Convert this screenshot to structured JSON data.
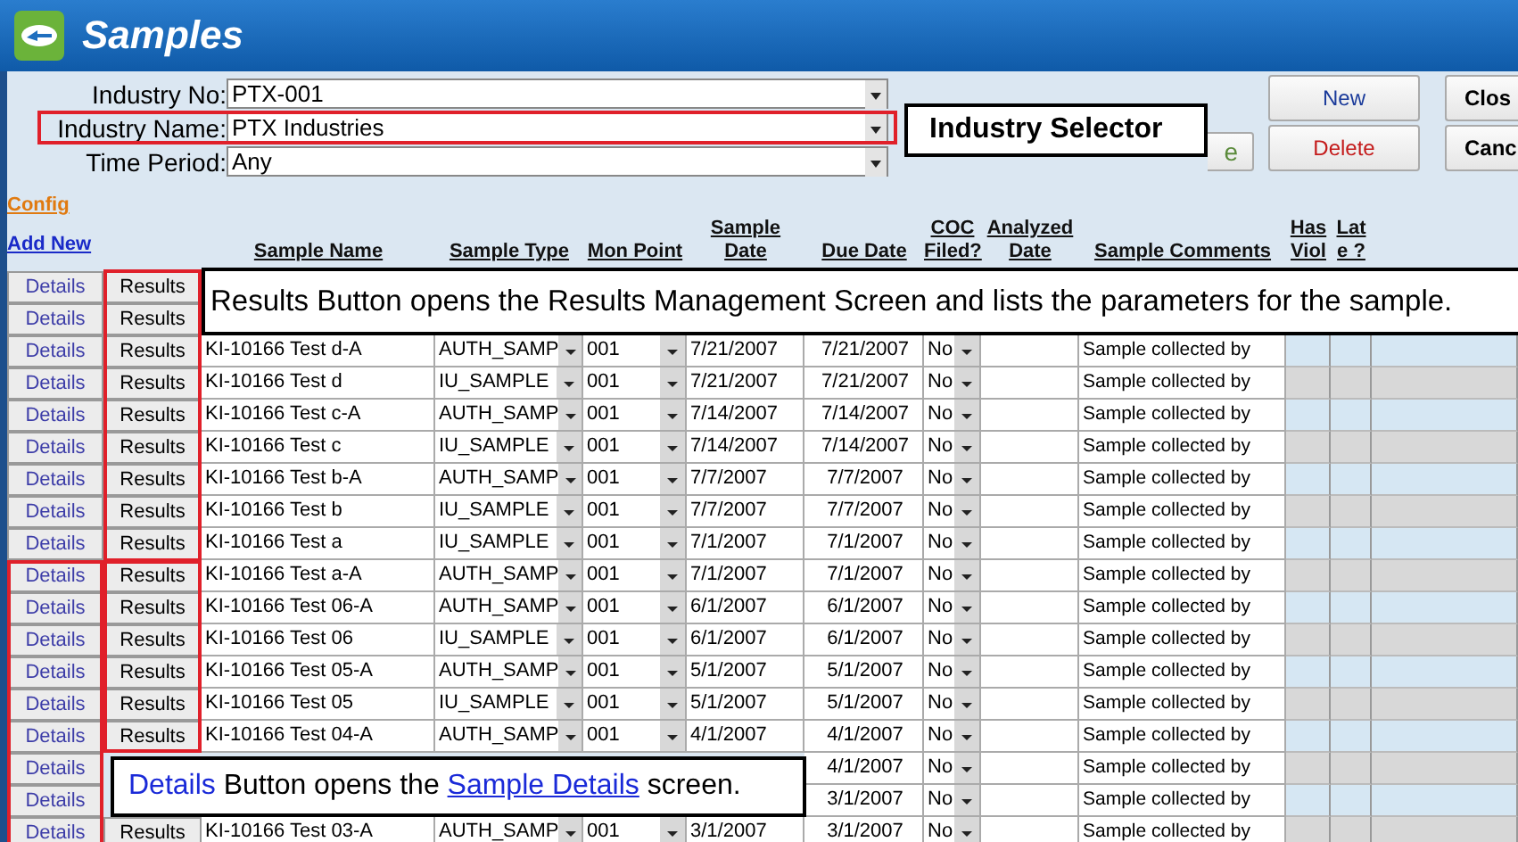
{
  "window": {
    "title": "Samples"
  },
  "form": [
    {
      "label": "Industry No:",
      "value": "PTX-001"
    },
    {
      "label": "Industry Name:",
      "value": "PTX Industries"
    },
    {
      "label": "Time Period:",
      "value": "Any"
    }
  ],
  "buttons": [
    {
      "label": "New",
      "kind": "new"
    },
    {
      "label": "Clos",
      "kind": "plain"
    },
    {
      "label": "e",
      "kind": "hidden"
    },
    {
      "label": "Delete",
      "kind": "delete"
    },
    {
      "label": "Canc",
      "kind": "plain"
    }
  ],
  "links": {
    "config": "Config",
    "add_new": "Add New"
  },
  "columns": [
    "Sample Name",
    "Sample Type",
    "Mon Point",
    "Sample Date",
    "Due Date",
    "COC Filed?",
    "Analyzed Date",
    "Sample Comments",
    "Has Viol",
    "Lat e ?"
  ],
  "rows": [
    {
      "details": "Details",
      "results": "Results"
    },
    {
      "details": "Details",
      "results": "Results"
    },
    {
      "details": "Details",
      "results": "Results",
      "name": "KI-10166 Test d-A",
      "type": "AUTH_SAMP",
      "mon": "001",
      "sample_date": "7/21/2007",
      "due_date": "7/21/2007",
      "coc": "No",
      "comment": "Sample collected by"
    },
    {
      "details": "Details",
      "results": "Results",
      "name": "KI-10166 Test d",
      "type": "IU_SAMPLE",
      "mon": "001",
      "sample_date": "7/21/2007",
      "due_date": "7/21/2007",
      "coc": "No",
      "comment": "Sample collected by"
    },
    {
      "details": "Details",
      "results": "Results",
      "name": "KI-10166 Test c-A",
      "type": "AUTH_SAMP",
      "mon": "001",
      "sample_date": "7/14/2007",
      "due_date": "7/14/2007",
      "coc": "No",
      "comment": "Sample collected by"
    },
    {
      "details": "Details",
      "results": "Results",
      "name": "KI-10166 Test c",
      "type": "IU_SAMPLE",
      "mon": "001",
      "sample_date": "7/14/2007",
      "due_date": "7/14/2007",
      "coc": "No",
      "comment": "Sample collected by"
    },
    {
      "details": "Details",
      "results": "Results",
      "name": "KI-10166 Test b-A",
      "type": "AUTH_SAMP",
      "mon": "001",
      "sample_date": "7/7/2007",
      "due_date": "7/7/2007",
      "coc": "No",
      "comment": "Sample collected by"
    },
    {
      "details": "Details",
      "results": "Results",
      "name": "KI-10166 Test b",
      "type": "IU_SAMPLE",
      "mon": "001",
      "sample_date": "7/7/2007",
      "due_date": "7/7/2007",
      "coc": "No",
      "comment": "Sample collected by"
    },
    {
      "details": "Details",
      "results": "Results",
      "name": "KI-10166 Test a",
      "type": "IU_SAMPLE",
      "mon": "001",
      "sample_date": "7/1/2007",
      "due_date": "7/1/2007",
      "coc": "No",
      "comment": "Sample collected by"
    },
    {
      "details": "Details",
      "results": "Results",
      "name": "KI-10166 Test a-A",
      "type": "AUTH_SAMP",
      "mon": "001",
      "sample_date": "7/1/2007",
      "due_date": "7/1/2007",
      "coc": "No",
      "comment": "Sample collected by"
    },
    {
      "details": "Details",
      "results": "Results",
      "name": "KI-10166 Test 06-A",
      "type": "AUTH_SAMP",
      "mon": "001",
      "sample_date": "6/1/2007",
      "due_date": "6/1/2007",
      "coc": "No",
      "comment": "Sample collected by"
    },
    {
      "details": "Details",
      "results": "Results",
      "name": "KI-10166 Test 06",
      "type": "IU_SAMPLE",
      "mon": "001",
      "sample_date": "6/1/2007",
      "due_date": "6/1/2007",
      "coc": "No",
      "comment": "Sample collected by"
    },
    {
      "details": "Details",
      "results": "Results",
      "name": "KI-10166 Test 05-A",
      "type": "AUTH_SAMP",
      "mon": "001",
      "sample_date": "5/1/2007",
      "due_date": "5/1/2007",
      "coc": "No",
      "comment": "Sample collected by"
    },
    {
      "details": "Details",
      "results": "Results",
      "name": "KI-10166 Test 05",
      "type": "IU_SAMPLE",
      "mon": "001",
      "sample_date": "5/1/2007",
      "due_date": "5/1/2007",
      "coc": "No",
      "comment": "Sample collected by"
    },
    {
      "details": "Details",
      "results": "Results",
      "name": "KI-10166 Test 04-A",
      "type": "AUTH_SAMP",
      "mon": "001",
      "sample_date": "4/1/2007",
      "due_date": "4/1/2007",
      "coc": "No",
      "comment": "Sample collected by"
    },
    {
      "details": "Details",
      "due_date": "4/1/2007",
      "coc": "No",
      "comment": "Sample collected by"
    },
    {
      "details": "Details",
      "due_date": "3/1/2007",
      "coc": "No",
      "comment": "Sample collected by"
    },
    {
      "details": "Details",
      "results": "Results",
      "name": "KI-10166 Test 03-A",
      "type": "AUTH_SAMP",
      "mon": "001",
      "sample_date": "3/1/2007",
      "due_date": "3/1/2007",
      "coc": "No",
      "comment": "Sample collected by"
    }
  ],
  "callouts": {
    "industry": "Industry Selector",
    "results": "Results Button opens the Results Management Screen and lists the parameters for the sample.",
    "details": {
      "link1": "Details",
      "middle": "Button opens the",
      "link2": "Sample Details",
      "tail": "screen."
    }
  }
}
